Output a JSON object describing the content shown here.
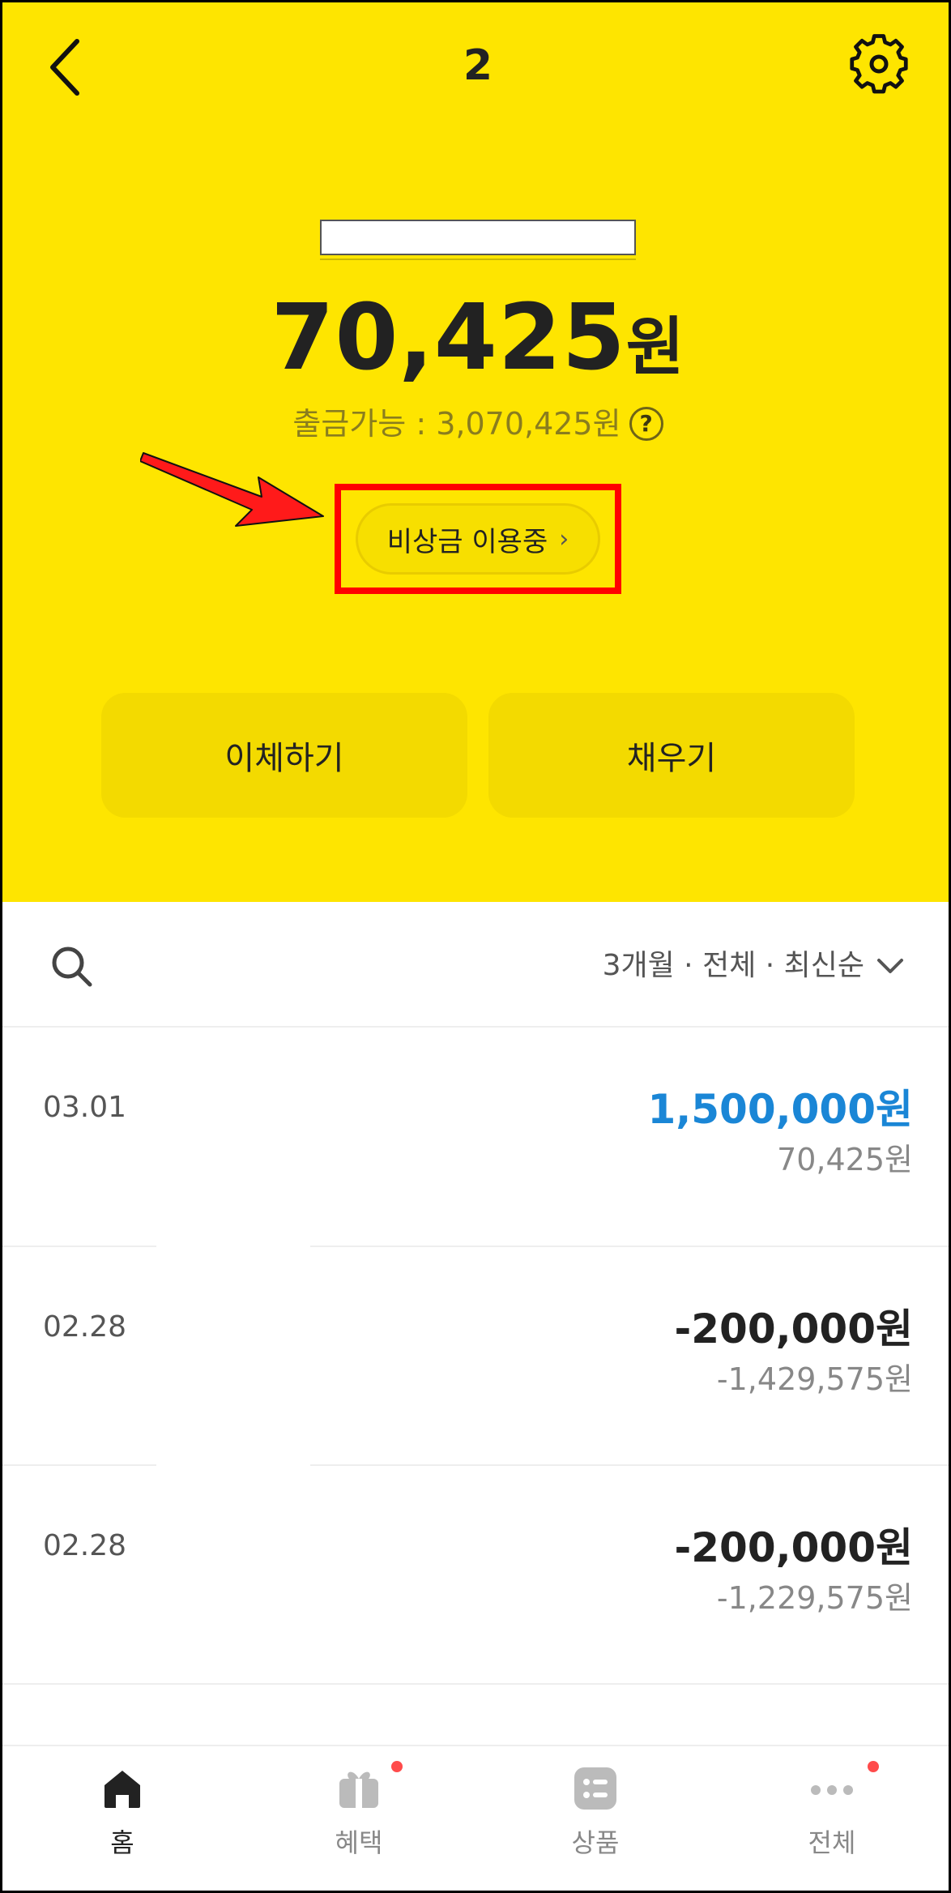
{
  "header": {
    "title": "2",
    "back_icon": "chevron-left-icon",
    "settings_icon": "gear-icon"
  },
  "account": {
    "balance_number": "70,425",
    "balance_unit": "원",
    "available_label": "출금가능 : 3,070,425원",
    "help_glyph": "?"
  },
  "emergency": {
    "label": "비상금 이용중",
    "chevron": "›"
  },
  "actions": {
    "transfer_label": "이체하기",
    "fill_label": "채우기"
  },
  "filter": {
    "label": "3개월 · 전체 · 최신순"
  },
  "transactions": [
    {
      "date": "03.01",
      "amount": "1,500,000원",
      "balance": "70,425원"
    },
    {
      "date": "02.28",
      "amount": "-200,000원",
      "balance": "-1,429,575원"
    },
    {
      "date": "02.28",
      "amount": "-200,000원",
      "balance": "-1,229,575원"
    }
  ],
  "nav": {
    "home": "홈",
    "benefits": "혜택",
    "products": "상품",
    "all": "전체"
  },
  "colors": {
    "brand_yellow": "#FEE500",
    "income_blue": "#1a86d6",
    "highlight_red": "#ff0000",
    "badge_red": "#ff4b4b"
  }
}
